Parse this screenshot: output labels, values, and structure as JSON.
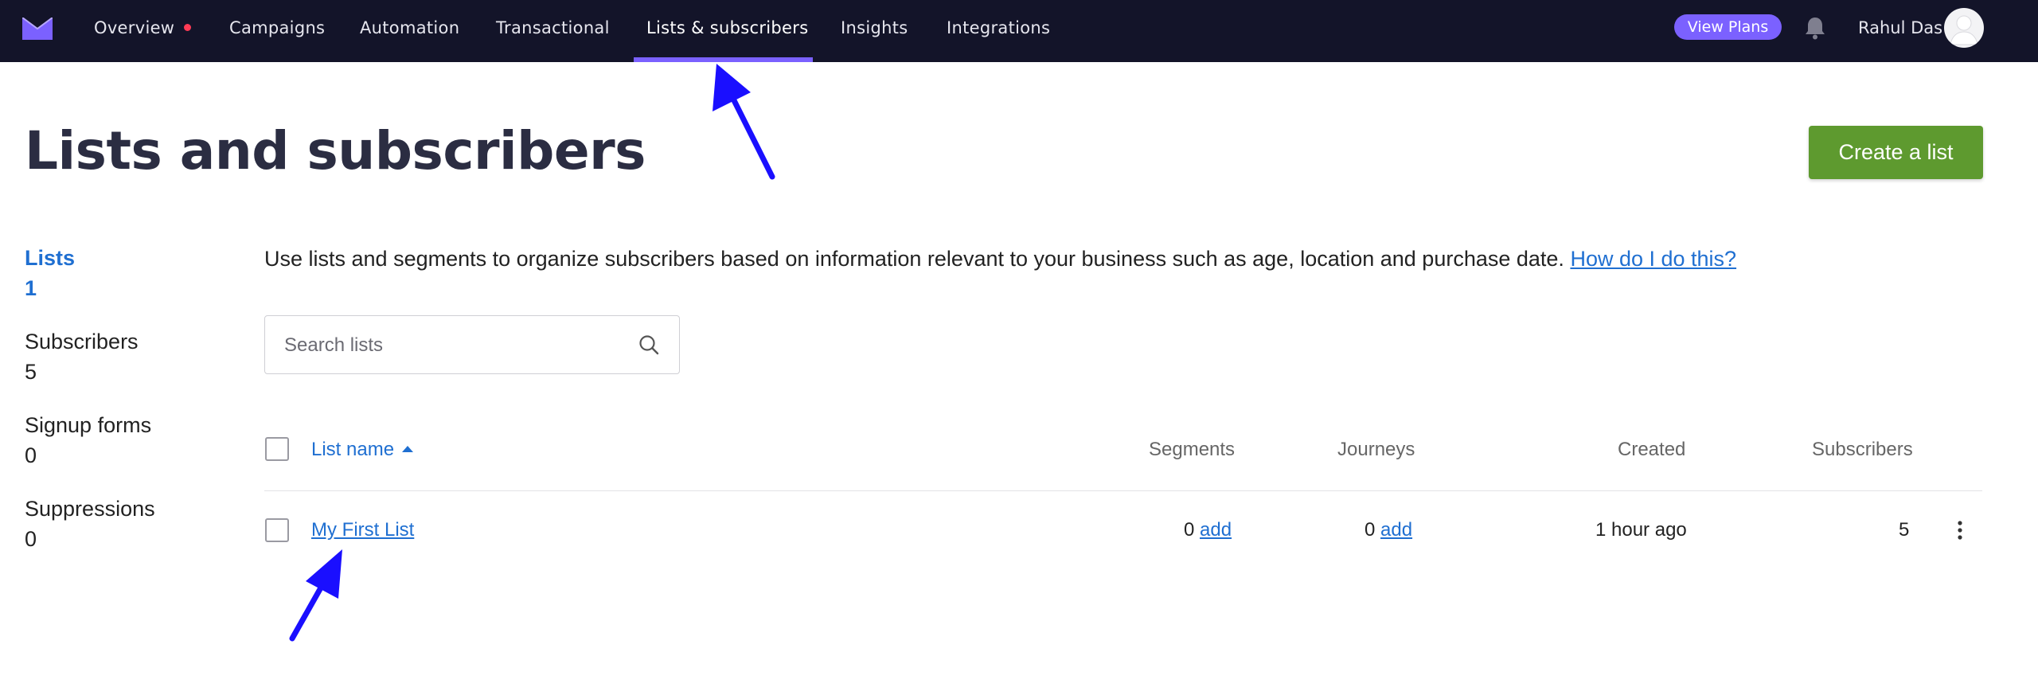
{
  "nav": {
    "items": [
      {
        "label": "Overview",
        "has_dot": true
      },
      {
        "label": "Campaigns"
      },
      {
        "label": "Automation"
      },
      {
        "label": "Transactional"
      },
      {
        "label": "Lists & subscribers",
        "active": true
      },
      {
        "label": "Insights"
      },
      {
        "label": "Integrations"
      }
    ],
    "view_plans": "View Plans",
    "user_name": "Rahul Das",
    "colors": {
      "bar": "#131429",
      "accent": "#7b61ff",
      "dot": "#ff3b55"
    }
  },
  "page": {
    "title": "Lists and subscribers",
    "create_button": "Create a list",
    "intro_text": "Use lists and segments to organize subscribers based on information relevant to your business such as age, location and purchase date.",
    "help_link": "How do I do this?"
  },
  "stats": [
    {
      "label": "Lists",
      "value": "1"
    },
    {
      "label": "Subscribers",
      "value": "5"
    },
    {
      "label": "Signup forms",
      "value": "0"
    },
    {
      "label": "Suppressions",
      "value": "0"
    }
  ],
  "search": {
    "placeholder": "Search lists",
    "value": ""
  },
  "table": {
    "headers": {
      "name": "List name",
      "segments": "Segments",
      "journeys": "Journeys",
      "created": "Created",
      "subscribers": "Subscribers"
    },
    "rows": [
      {
        "name": "My First List",
        "segments": "0",
        "segments_add": "add",
        "journeys": "0",
        "journeys_add": "add",
        "created": "1 hour ago",
        "subscribers": "5"
      }
    ]
  },
  "icons": [
    "mail-logo-icon",
    "bell-icon",
    "avatar-icon",
    "search-icon",
    "sort-up-icon",
    "more-vertical-icon",
    "annotation-arrow-icon"
  ]
}
